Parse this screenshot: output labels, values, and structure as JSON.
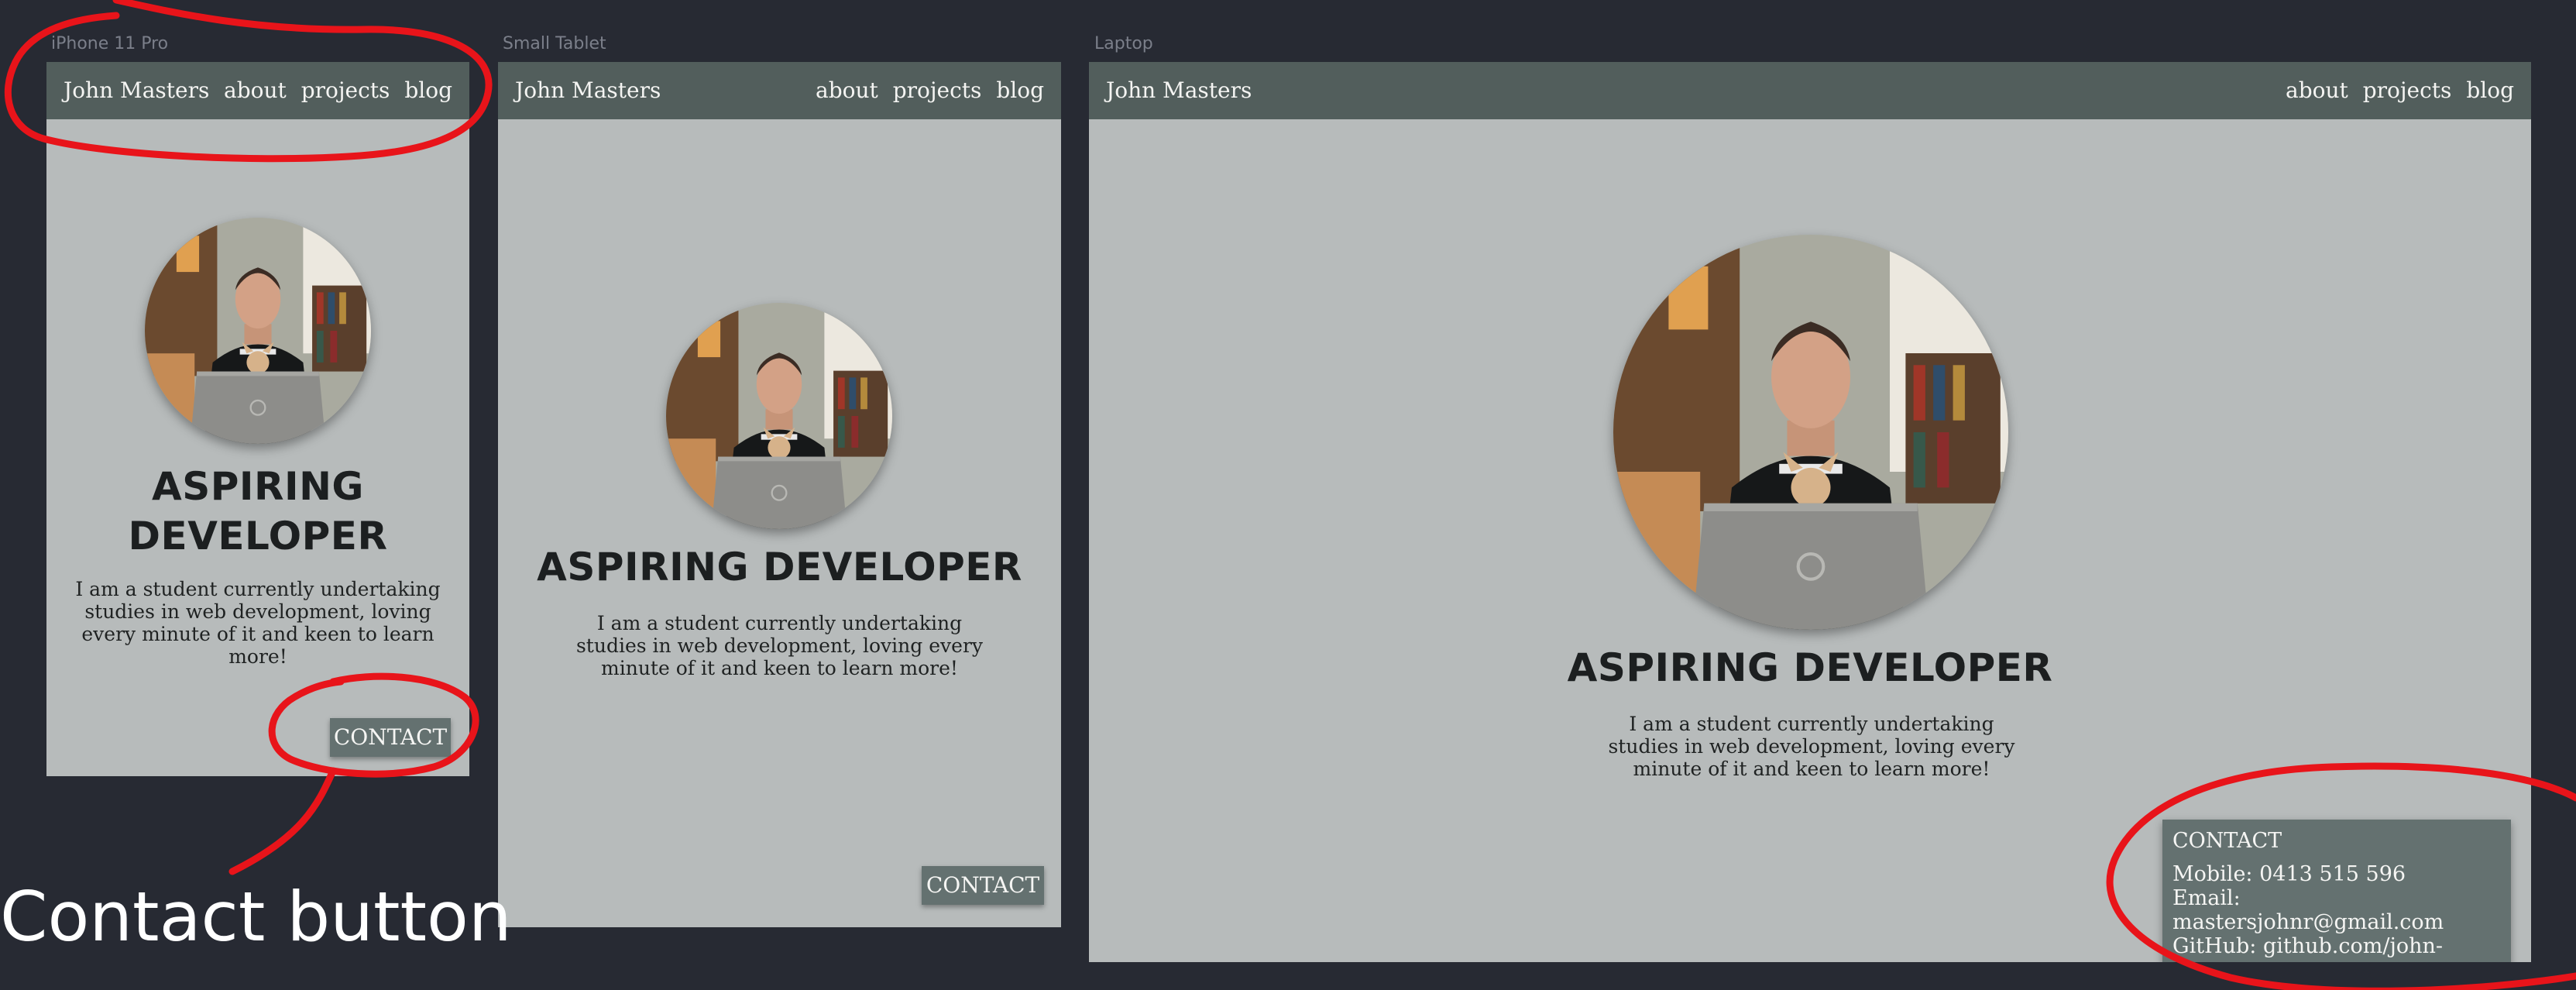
{
  "frames": {
    "phone": {
      "label": "iPhone 11 Pro",
      "brand": "John Masters",
      "nav": [
        "about",
        "projects",
        "blog"
      ],
      "headline_line1": "ASPIRING",
      "headline_line2": "DEVELOPER",
      "bio": "I am a student currently undertaking studies in web development, loving every minute of it and keen to learn more!",
      "contact": "CONTACT"
    },
    "tablet": {
      "label": "Small Tablet",
      "brand": "John Masters",
      "nav": [
        "about",
        "projects",
        "blog"
      ],
      "headline": "ASPIRING DEVELOPER",
      "bio": "I am a student currently undertaking studies in web development, loving every minute of it and keen to learn more!",
      "contact": "CONTACT"
    },
    "laptop": {
      "label": "Laptop",
      "brand": "John Masters",
      "nav": [
        "about",
        "projects",
        "blog"
      ],
      "headline": "ASPIRING DEVELOPER",
      "bio": "I am a student currently undertaking studies in web development, loving every minute of it and keen to learn more!",
      "contact_panel": {
        "title": "CONTACT",
        "mobile": "Mobile: 0413 515 596",
        "email": "Email: mastersjohnr@gmail.com",
        "github": "GitHub: github.com/john-masters"
      }
    }
  },
  "annotation": {
    "text": "Contact button"
  },
  "colors": {
    "canvas": "#272a33",
    "frame_bg": "#b7bbbb",
    "navbar": "#525e5c",
    "button": "#647170",
    "annotation_stroke": "#e8141a"
  }
}
